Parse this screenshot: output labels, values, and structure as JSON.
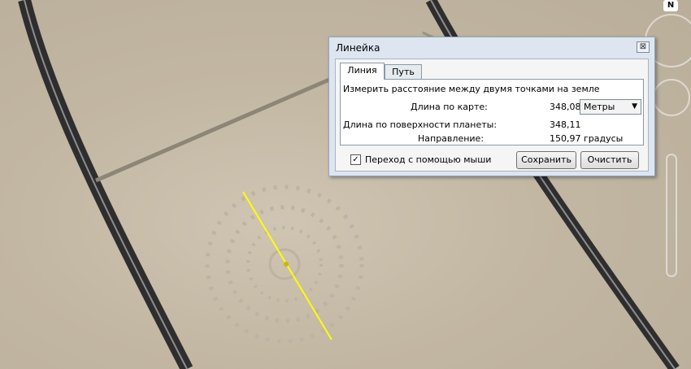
{
  "dialog": {
    "title": "Линейка",
    "close_glyph": "⊠",
    "tabs": [
      "Линия",
      "Путь"
    ],
    "active_tab": "Линия",
    "instruction": "Измерить расстояние между двумя точками на земле",
    "map_length_label": "Длина по карте:",
    "map_length_value": "348,08",
    "unit_selected": "Метры",
    "ground_length_label": "Длина по поверхности планеты:",
    "ground_length_value": "348,11",
    "heading_label": "Направление:",
    "heading_value": "150,97 градусы",
    "mouse_nav_label": "Переход с помощью мыши",
    "mouse_nav_checked": true,
    "save_label": "Сохранить",
    "clear_label": "Очистить"
  },
  "compass": {
    "north_label": "N"
  },
  "ruler": {
    "color": "#ffff00"
  }
}
